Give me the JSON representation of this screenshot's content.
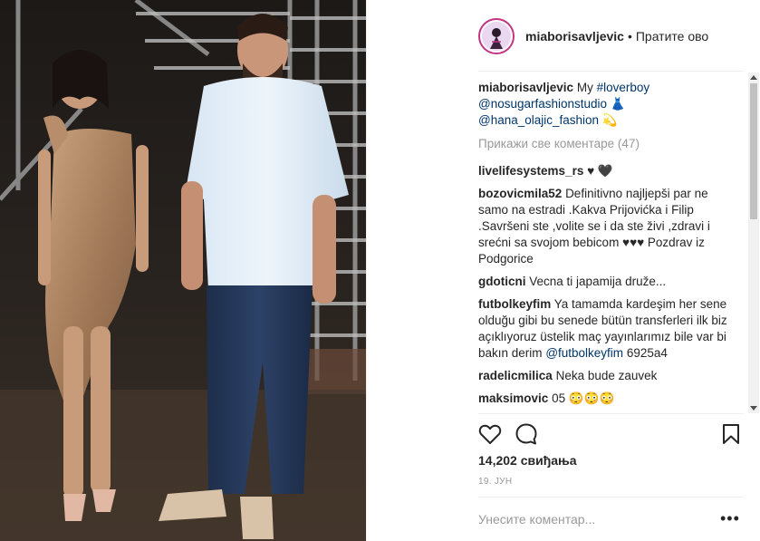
{
  "post": {
    "username": "miaborisavljevic",
    "follow_label": "Пратите ово",
    "separator": "•",
    "caption_text": "My",
    "caption_hashtag": "#loverboy",
    "caption_mention1": "@nosugarfashionstudio",
    "caption_mention2": "@hana_olajic_fashion",
    "view_all_comments": "Прикажи све коментаре (47)",
    "likes": "14,202 свиђања",
    "date": "19. ЈУН",
    "add_comment_placeholder": "Унесите коментар...",
    "more_icon": "•••"
  },
  "comments": [
    {
      "user": "livelifesystems_rs",
      "text": "♥ 🖤"
    },
    {
      "user": "bozovicmila52",
      "text": "Definitivno najljepši par ne samo na estradi .Kakva Prijovićka i Filip .Savršeni ste ,volite se i da ste živi ,zdravi i srećni sa svojom bebicom ♥♥♥ Pozdrav iz Podgorice"
    },
    {
      "user": "gdoticni",
      "text": "Vecna ti japamija druže..."
    },
    {
      "user": "futbolkeyfim",
      "text": "Ya tamamda kardeşim her sene olduğu gibi bu senede bütün transferleri ilk biz açıklıyoruz üstelik maç yayınlarımız bile var bi bakın derim",
      "mention": "@futbolkeyfim",
      "tail": "6925a4"
    },
    {
      "user": "radelicmilica",
      "text": "Neka bude zauvek"
    },
    {
      "user": "maksimovic",
      "text": "05 😳😳😳"
    }
  ],
  "icons": {
    "like": "heart-icon",
    "comment": "comment-icon",
    "save": "bookmark-icon",
    "more": "more-options-icon"
  }
}
